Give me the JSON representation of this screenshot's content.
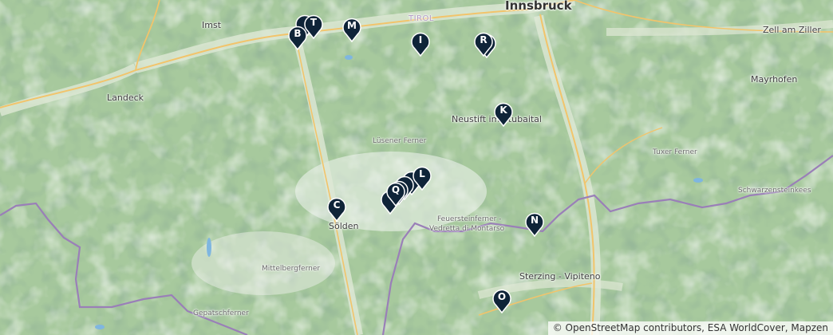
{
  "map": {
    "labels": {
      "innsbruck": "Innsbruck",
      "tirol": "TIROL",
      "imst": "Imst",
      "landeck": "Landeck",
      "zell_am_ziller": "Zell am Ziller",
      "mayrhofen": "Mayrhofen",
      "neustift": "Neustift im Stubaital",
      "lusener_ferner": "Lüsener Ferner",
      "tuxer_ferner": "Tuxer Ferner",
      "schwarzenstein": "Schwarzensteinkees",
      "feuerstein": "Feuersteinferner -",
      "montarso": "Vedretta di Montarso",
      "solden": "Sölden",
      "mittelberg": "Mittelbergferner",
      "sterzing": "Sterzing - Vipiteno",
      "gepatsch": "Gepatschferner"
    },
    "markers": [
      {
        "label": "B"
      },
      {
        "label": "T"
      },
      {
        "label": "M"
      },
      {
        "label": "I"
      },
      {
        "label": "R"
      },
      {
        "label": "K"
      },
      {
        "label": "L"
      },
      {
        "label": "Q"
      },
      {
        "label": "C"
      },
      {
        "label": "N"
      },
      {
        "label": "O"
      }
    ],
    "attribution": "© OpenStreetMap contributors, ESA WorldCover, Mapzen"
  }
}
